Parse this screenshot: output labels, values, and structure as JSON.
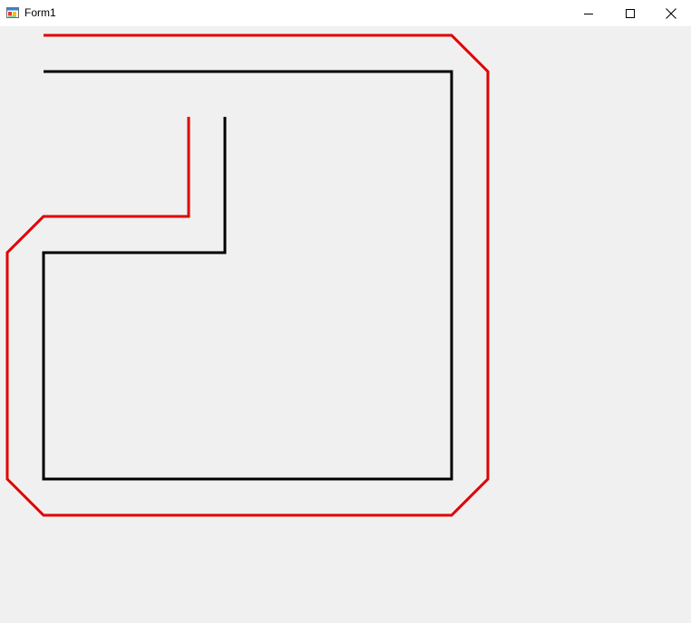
{
  "window": {
    "title": "Form1"
  },
  "icons": {
    "app": "winforms-app-icon",
    "minimize": "minimize-icon",
    "maximize": "maximize-icon",
    "close": "close-icon"
  },
  "colors": {
    "outer_path": "#e00000",
    "inner_path": "#000000",
    "background": "#f0f0f0",
    "titlebar": "#ffffff"
  }
}
